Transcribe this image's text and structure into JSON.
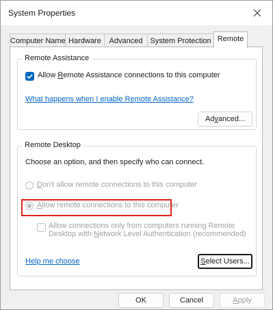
{
  "window": {
    "title": "System Properties"
  },
  "tabs": [
    {
      "label": "Computer Name"
    },
    {
      "label": "Hardware"
    },
    {
      "label": "Advanced"
    },
    {
      "label": "System Protection"
    },
    {
      "label": "Remote",
      "active": true
    }
  ],
  "remote_assistance": {
    "group_title": "Remote Assistance",
    "allow_checkbox": {
      "label_pre": "Allow ",
      "label_mnemonic": "R",
      "label_post": "emote Assistance connections to this computer",
      "checked": true
    },
    "help_link": "What happens when I enable Remote Assistance?",
    "advanced_button": {
      "pre": "Ad",
      "mnemonic": "v",
      "post": "anced..."
    }
  },
  "remote_desktop": {
    "group_title": "Remote Desktop",
    "instruction": "Choose an option, and then specify who can connect.",
    "option_dont_allow": {
      "mnemonic": "D",
      "post": "on't allow remote connections to this computer",
      "selected": false,
      "enabled": false
    },
    "option_allow": {
      "mnemonic": "A",
      "post": "llow remote connections to this computer",
      "selected": true,
      "enabled": false
    },
    "nla_checkbox": {
      "line1": "Allow connections only from computers running Remote",
      "line2_pre": "Desktop with ",
      "line2_mnemonic": "N",
      "line2_post": "etwork Level Authentication (recommended)",
      "checked": false,
      "enabled": false
    },
    "help_link": "Help me choose",
    "select_users_button": {
      "mnemonic": "S",
      "post": "elect Users..."
    }
  },
  "footer": {
    "ok": "OK",
    "cancel": "Cancel",
    "apply": {
      "mnemonic": "A",
      "post": "pply"
    }
  },
  "colors": {
    "accent": "#0067c0",
    "link": "#0066cc",
    "highlight_box": "#e0201b",
    "disabled_text": "#a0a0a0"
  }
}
